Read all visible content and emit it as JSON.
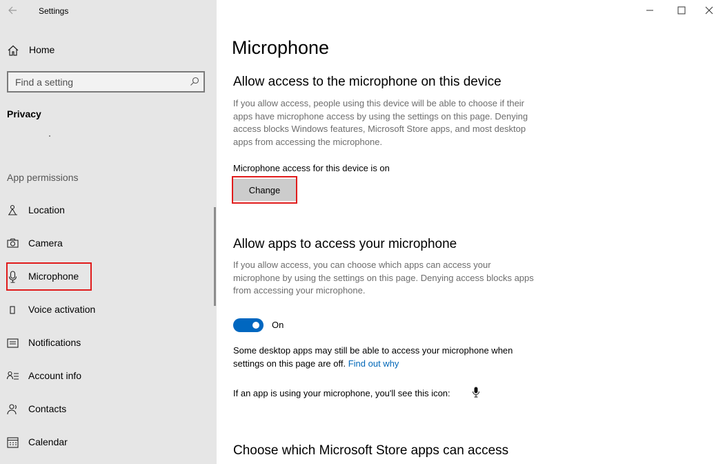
{
  "window": {
    "title": "Settings",
    "controls": [
      "minimize",
      "maximize",
      "close"
    ]
  },
  "sidebar": {
    "home_label": "Home",
    "search_placeholder": "Find a setting",
    "section_title": "Privacy",
    "group_title": "App permissions",
    "items": [
      {
        "label": "Location",
        "icon": "location-icon"
      },
      {
        "label": "Camera",
        "icon": "camera-icon"
      },
      {
        "label": "Microphone",
        "icon": "microphone-icon",
        "selected": true
      },
      {
        "label": "Voice activation",
        "icon": "voice-activation-icon"
      },
      {
        "label": "Notifications",
        "icon": "notifications-icon"
      },
      {
        "label": "Account info",
        "icon": "account-info-icon"
      },
      {
        "label": "Contacts",
        "icon": "contacts-icon"
      },
      {
        "label": "Calendar",
        "icon": "calendar-icon"
      }
    ]
  },
  "main": {
    "title": "Microphone",
    "device_section": {
      "heading": "Allow access to the microphone on this device",
      "description": "If you allow access, people using this device will be able to choose if their apps have microphone access by using the settings on this page. Denying access blocks Windows features, Microsoft Store apps, and most desktop apps from accessing the microphone.",
      "status": "Microphone access for this device is on",
      "button_label": "Change"
    },
    "apps_section": {
      "heading": "Allow apps to access your microphone",
      "description": "If you allow access, you can choose which apps can access your microphone by using the settings on this page. Denying access blocks apps from accessing your microphone.",
      "toggle_state": "On",
      "note_text": "Some desktop apps may still be able to access your microphone when settings on this page are off.",
      "note_link": "Find out why",
      "icon_note": "If an app is using your microphone, you'll see this icon:"
    },
    "store_section": {
      "heading": "Choose which Microsoft Store apps can access"
    }
  },
  "colors": {
    "sidebar_bg": "#e6e6e6",
    "accent": "#0067c0",
    "link": "#0067b8",
    "highlight": "#e01b1b"
  }
}
